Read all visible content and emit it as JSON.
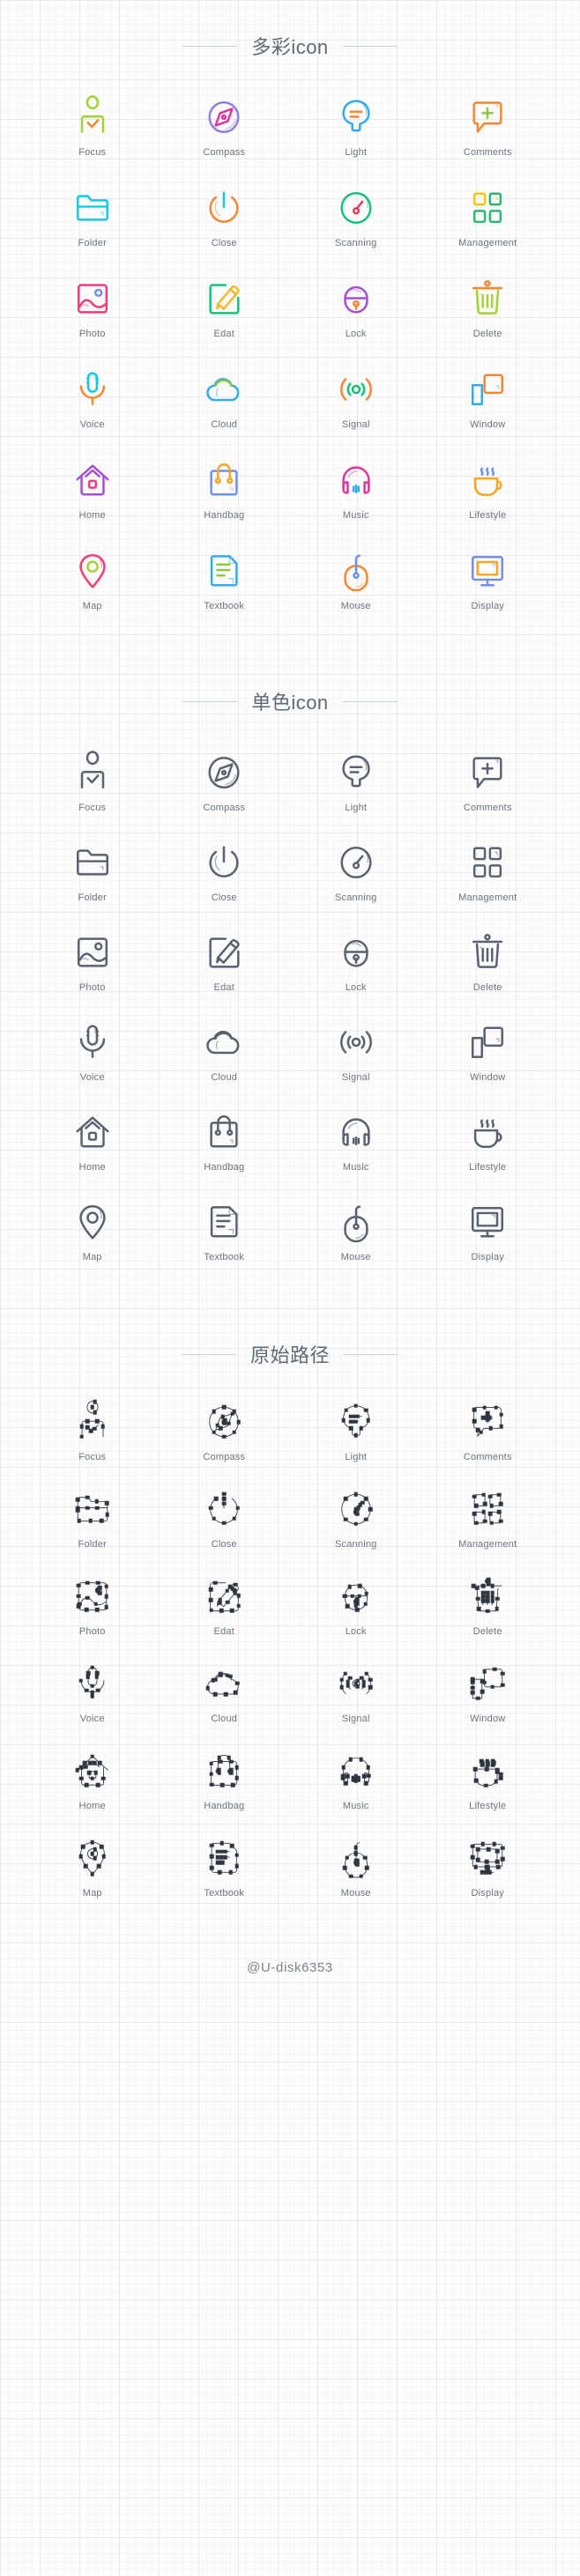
{
  "sections": [
    {
      "id": "colorful",
      "title": "多彩icon"
    },
    {
      "id": "mono",
      "title": "单色icon"
    },
    {
      "id": "path",
      "title": "原始路径"
    }
  ],
  "mono_color": "#5a6170",
  "path_color": "#2f3540",
  "icons": [
    {
      "key": "focus",
      "label": "Focus",
      "primary": "#a3d234",
      "secondary": "#f58634"
    },
    {
      "key": "compass",
      "label": "Compass",
      "primary": "#8b7fe0",
      "secondary": "#e0359e"
    },
    {
      "key": "light",
      "label": "Light",
      "primary": "#33aaf0",
      "secondary": "#f58634"
    },
    {
      "key": "comments",
      "label": "Comments",
      "primary": "#f58634",
      "secondary": "#8dc63f"
    },
    {
      "key": "folder",
      "label": "Folder",
      "primary": "#16c7e0",
      "secondary": "#16c7e0"
    },
    {
      "key": "close",
      "label": "Close",
      "primary": "#f58634",
      "secondary": "#16c7e0"
    },
    {
      "key": "scanning",
      "label": "Scanning",
      "primary": "#14c07a",
      "secondary": "#f0395a"
    },
    {
      "key": "management",
      "label": "Management",
      "primary": "#f6c514",
      "secondary": "#2bb673"
    },
    {
      "key": "photo",
      "label": "Photo",
      "primary": "#f03d7a",
      "secondary": "#6f8fe8"
    },
    {
      "key": "edat",
      "label": "Edat",
      "primary": "#10c47c",
      "secondary": "#f5b82e"
    },
    {
      "key": "lock",
      "label": "Lock",
      "primary": "#a44fd0",
      "secondary": "#f58634"
    },
    {
      "key": "delete",
      "label": "Delete",
      "primary": "#a3d234",
      "secondary": "#f58634"
    },
    {
      "key": "voice",
      "label": "Voice",
      "primary": "#16c7e0",
      "secondary": "#f58634"
    },
    {
      "key": "cloud",
      "label": "Cloud",
      "primary": "#33aaf0",
      "secondary": "#8dc63f"
    },
    {
      "key": "signal",
      "label": "Signal",
      "primary": "#f58634",
      "secondary": "#14c07a"
    },
    {
      "key": "window",
      "label": "Window",
      "primary": "#33aaf0",
      "secondary": "#f58634"
    },
    {
      "key": "home",
      "label": "Home",
      "primary": "#a44fd0",
      "secondary": "#f03d7a"
    },
    {
      "key": "handbag",
      "label": "Handbag",
      "primary": "#6f8fe8",
      "secondary": "#f5a623"
    },
    {
      "key": "music",
      "label": "Music",
      "primary": "#e0359e",
      "secondary": "#33aaf0"
    },
    {
      "key": "lifestyle",
      "label": "Lifestyle",
      "primary": "#f5a623",
      "secondary": "#6f8fe8"
    },
    {
      "key": "map",
      "label": "Map",
      "primary": "#f03d7a",
      "secondary": "#a3d234"
    },
    {
      "key": "textbook",
      "label": "Textbook",
      "primary": "#33aaf0",
      "secondary": "#8dc63f"
    },
    {
      "key": "mouse",
      "label": "Mouse",
      "primary": "#f58634",
      "secondary": "#6f8fe8"
    },
    {
      "key": "display",
      "label": "Display",
      "primary": "#6f8fe8",
      "secondary": "#f5a623"
    }
  ],
  "footer": {
    "watermark": "@U-disk6353"
  }
}
